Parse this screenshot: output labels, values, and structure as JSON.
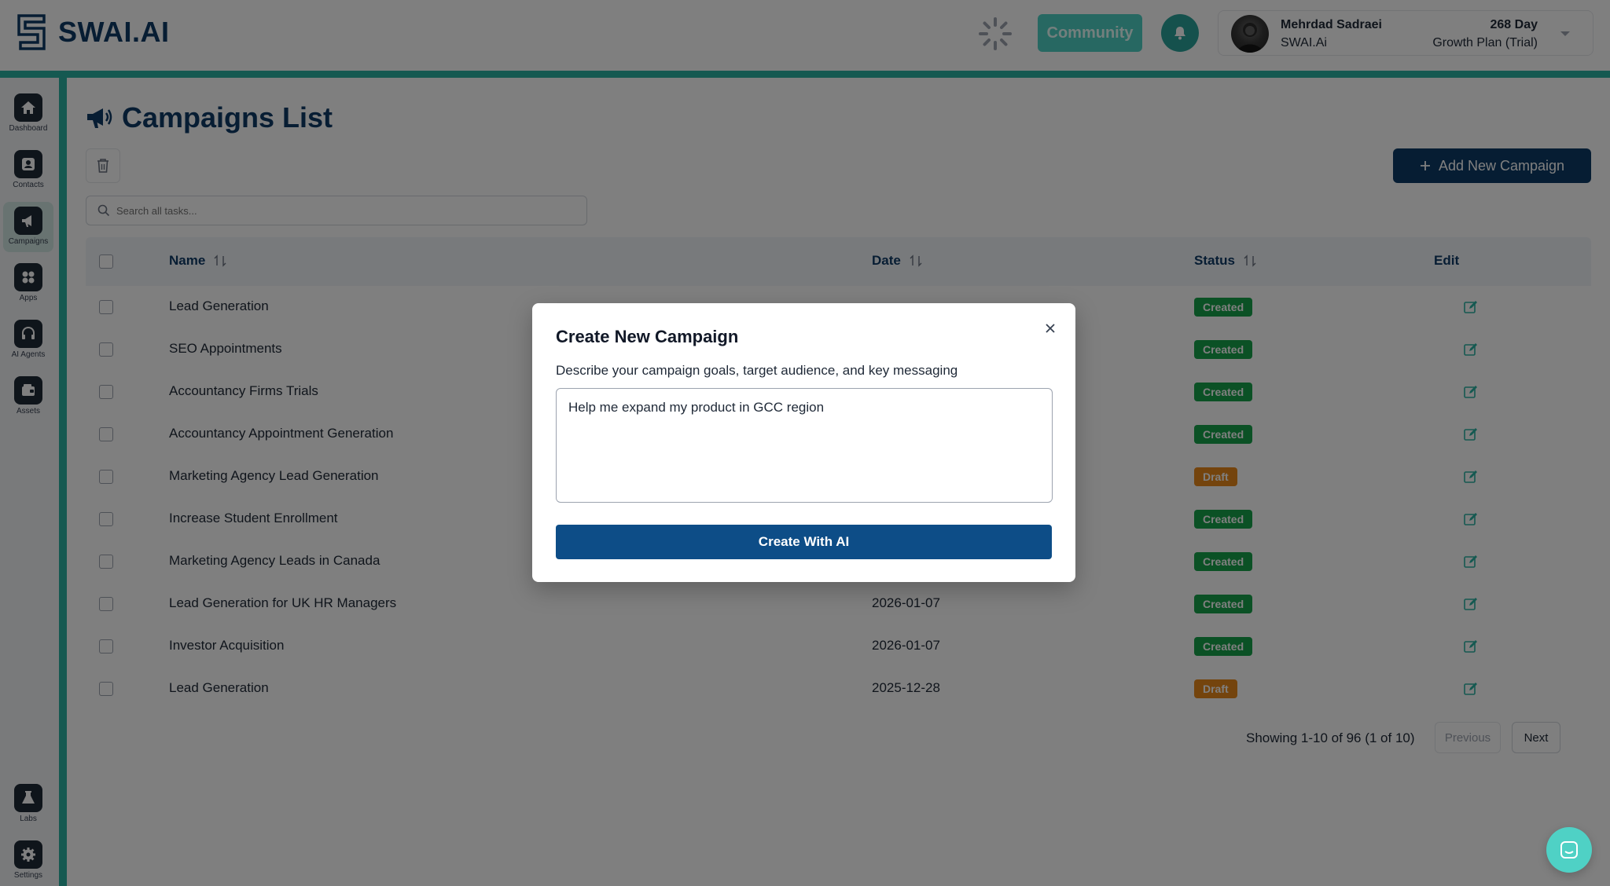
{
  "brand": {
    "name": "SWAI.AI"
  },
  "topbar": {
    "community_label": "Community",
    "user": {
      "name": "Mehrdad Sadraei",
      "org": "SWAI.Ai",
      "plan_days": "268 Day",
      "plan_name": "Growth Plan (Trial)"
    }
  },
  "sidebar": {
    "items": [
      {
        "label": "Dashboard",
        "icon": "home-icon"
      },
      {
        "label": "Contacts",
        "icon": "contacts-icon"
      },
      {
        "label": "Campaigns",
        "icon": "megaphone-icon",
        "active": true
      },
      {
        "label": "Apps",
        "icon": "apps-grid-icon"
      },
      {
        "label": "AI Agents",
        "icon": "headset-icon"
      },
      {
        "label": "Assets",
        "icon": "wallet-icon"
      }
    ],
    "bottom_items": [
      {
        "label": "Labs",
        "icon": "flask-icon"
      },
      {
        "label": "Settings",
        "icon": "gear-icon"
      }
    ]
  },
  "page": {
    "title": "Campaigns List",
    "add_button_label": "Add New Campaign",
    "search_placeholder": "Search all tasks..."
  },
  "table": {
    "columns": [
      "Name",
      "Date",
      "Status",
      "Edit"
    ],
    "rows": [
      {
        "name": "Lead Generation",
        "date": "",
        "status": "Created"
      },
      {
        "name": "SEO Appointments",
        "date": "",
        "status": "Created"
      },
      {
        "name": "Accountancy Firms Trials",
        "date": "",
        "status": "Created"
      },
      {
        "name": "Accountancy Appointment Generation",
        "date": "",
        "status": "Created"
      },
      {
        "name": "Marketing Agency Lead Generation",
        "date": "",
        "status": "Draft"
      },
      {
        "name": "Increase Student Enrollment",
        "date": "",
        "status": "Created"
      },
      {
        "name": "Marketing Agency Leads in Canada",
        "date": "",
        "status": "Created"
      },
      {
        "name": "Lead Generation for UK HR Managers",
        "date": "2026-01-07",
        "status": "Created"
      },
      {
        "name": "Investor Acquisition",
        "date": "2026-01-07",
        "status": "Created"
      },
      {
        "name": "Lead Generation",
        "date": "2025-12-28",
        "status": "Draft"
      }
    ]
  },
  "pagination": {
    "summary": "Showing 1-10 of 96 (1 of 10)",
    "previous_label": "Previous",
    "next_label": "Next"
  },
  "modal": {
    "title": "Create New Campaign",
    "description": "Describe your campaign goals, target audience, and key messaging",
    "textarea_value": "Help me expand my product in GCC region",
    "create_label": "Create With AI"
  },
  "colors": {
    "brand_navy": "#0f3a66",
    "accent_teal": "#2bb3a3",
    "status_created": "#16a34a",
    "status_draft": "#e8891a"
  }
}
